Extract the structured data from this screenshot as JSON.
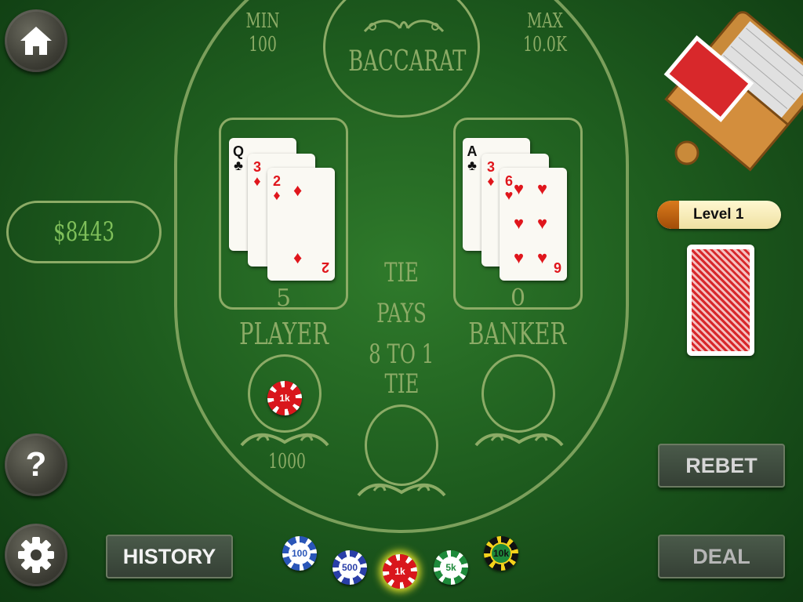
{
  "table": {
    "min_label": "MIN 100",
    "max_label": "MAX 10.0K",
    "title": "BACCARAT",
    "tie_pays_line1": "TIE PAYS",
    "tie_pays_line2": "8 TO 1",
    "player_label": "PLAYER",
    "banker_label": "BANKER",
    "tie_label": "TIE",
    "player_score": "5",
    "banker_score": "0",
    "player_bet_amount": "1000",
    "player_bet_chip": "1k"
  },
  "player_cards": [
    {
      "rank": "Q",
      "suit": "♣",
      "color": "black"
    },
    {
      "rank": "3",
      "suit": "♦",
      "color": "red"
    },
    {
      "rank": "2",
      "suit": "♦",
      "color": "red"
    }
  ],
  "banker_cards": [
    {
      "rank": "A",
      "suit": "♣",
      "color": "black"
    },
    {
      "rank": "3",
      "suit": "♦",
      "color": "red"
    },
    {
      "rank": "6",
      "suit": "♥",
      "color": "red"
    }
  ],
  "balance": "$8443",
  "level": {
    "label": "Level 1",
    "progress": 0.18
  },
  "buttons": {
    "home_icon": "home-icon",
    "help_icon": "question-icon",
    "settings_icon": "gear-icon",
    "history": "HISTORY",
    "rebet": "REBET",
    "deal": "DEAL"
  },
  "chips": [
    {
      "label": "100",
      "color": "#2a56b8",
      "ring": "#ffffff"
    },
    {
      "label": "500",
      "color": "#2a3fa8",
      "ring": "#ffffff"
    },
    {
      "label": "1k",
      "color": "#d9161c",
      "ring": "#ffffff",
      "selected": true
    },
    {
      "label": "5k",
      "color": "#1e8a3b",
      "ring": "#ffffff"
    },
    {
      "label": "10k",
      "color": "#111111",
      "ring": "#f4d21b"
    }
  ],
  "colors": {
    "felt": "#23622a",
    "line": "#8cab66",
    "button_text": "#e6e6e6"
  }
}
